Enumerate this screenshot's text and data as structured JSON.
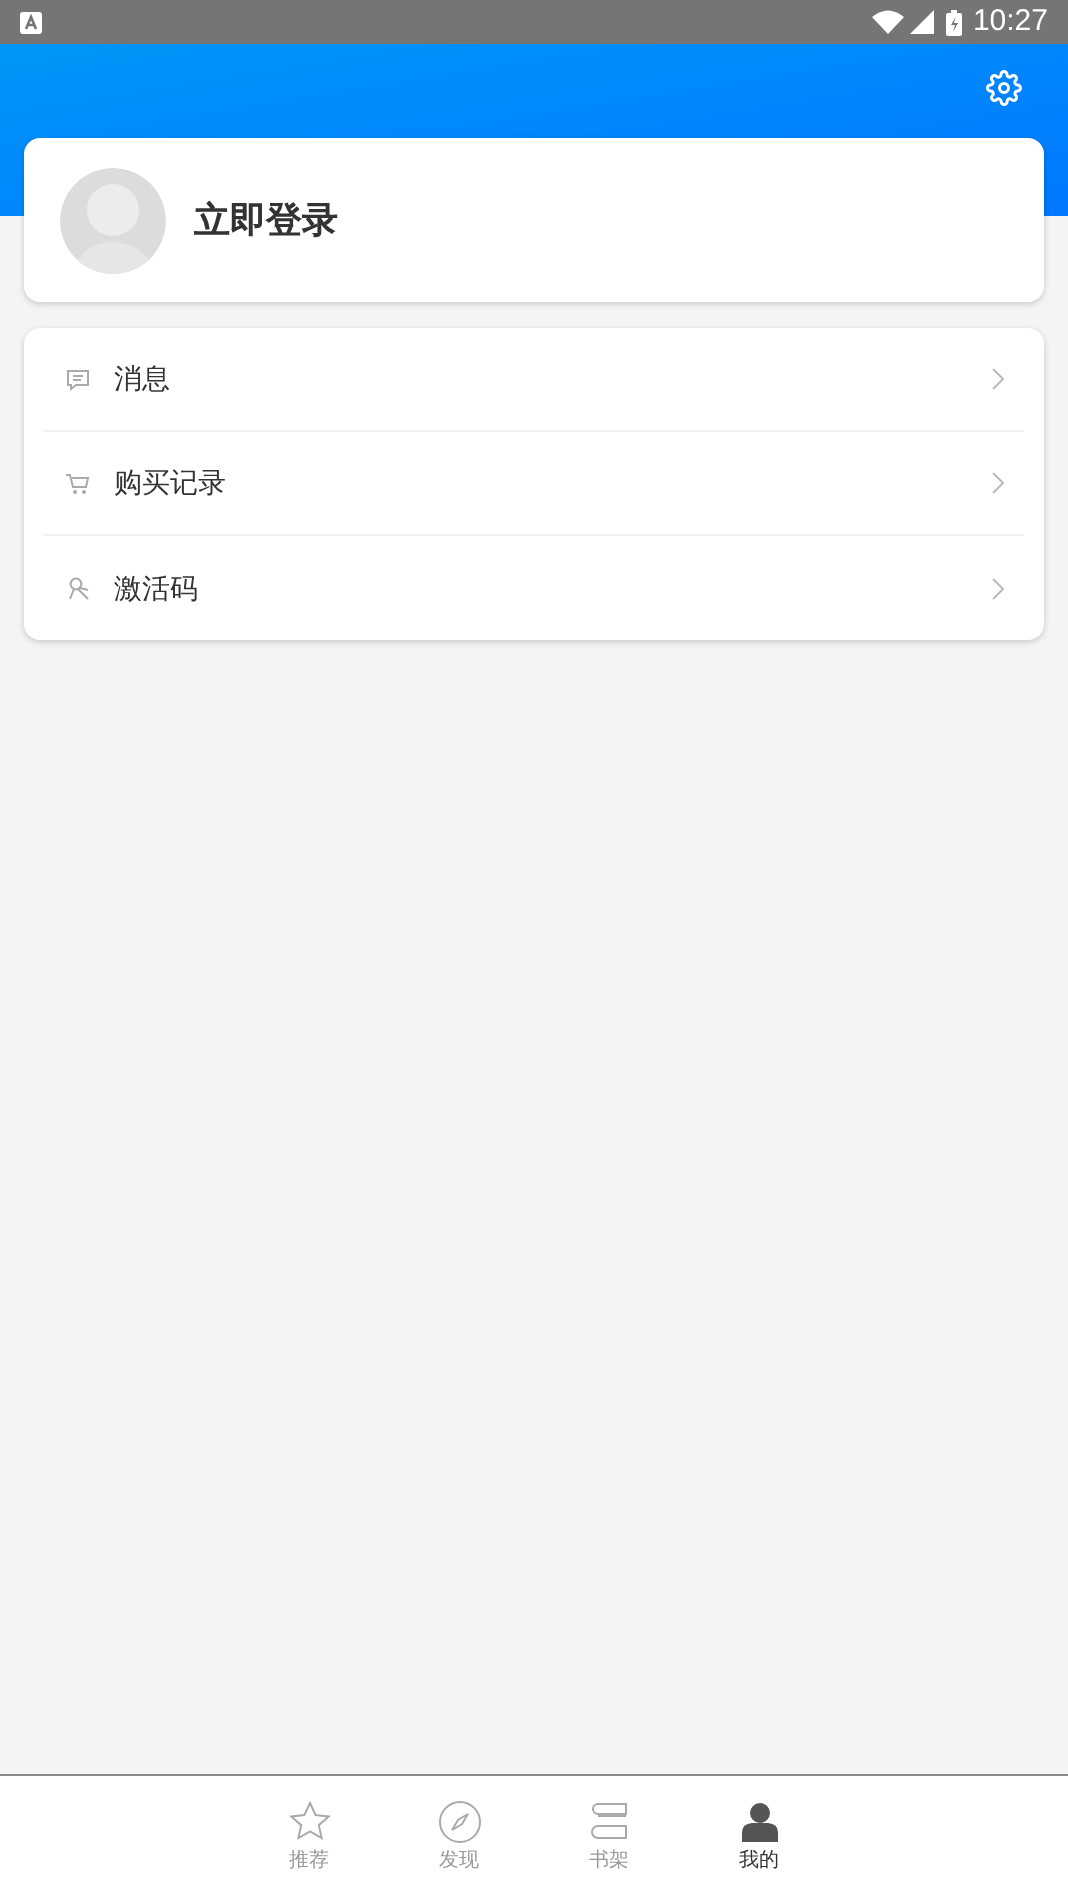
{
  "status_bar": {
    "time": "10:27"
  },
  "profile": {
    "login_label": "立即登录"
  },
  "menu": [
    {
      "kind": "message",
      "label": "消息"
    },
    {
      "kind": "cart",
      "label": "购买记录"
    },
    {
      "kind": "key",
      "label": "激活码"
    }
  ],
  "tabs": [
    {
      "kind": "star",
      "label": "推荐",
      "selected": false
    },
    {
      "kind": "compass",
      "label": "发现",
      "selected": false
    },
    {
      "kind": "shelf",
      "label": "书架",
      "selected": false
    },
    {
      "kind": "person",
      "label": "我的",
      "selected": true
    }
  ]
}
